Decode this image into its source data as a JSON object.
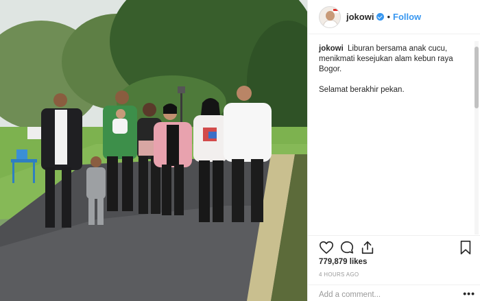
{
  "post": {
    "username": "jokowi",
    "follow_label": "Follow",
    "separator": "•",
    "caption_user": "jokowi",
    "caption_line1": "Liburan bersama anak cucu, menikmati kesejukan alam kebun raya Bogor.",
    "caption_line2": "Selamat berakhir pekan.",
    "likes": "779,879 likes",
    "time": "4 HOURS AGO",
    "comment_placeholder": "Add a comment...",
    "more_label": "•••"
  },
  "icons": {
    "header": [
      "avatar",
      "verified-icon"
    ],
    "actions": [
      "heart-icon",
      "comment-icon",
      "share-icon",
      "bookmark-icon"
    ]
  },
  "colors": {
    "accent": "#3897f0",
    "text": "#262626",
    "muted": "#999999",
    "divider": "#efefef"
  }
}
